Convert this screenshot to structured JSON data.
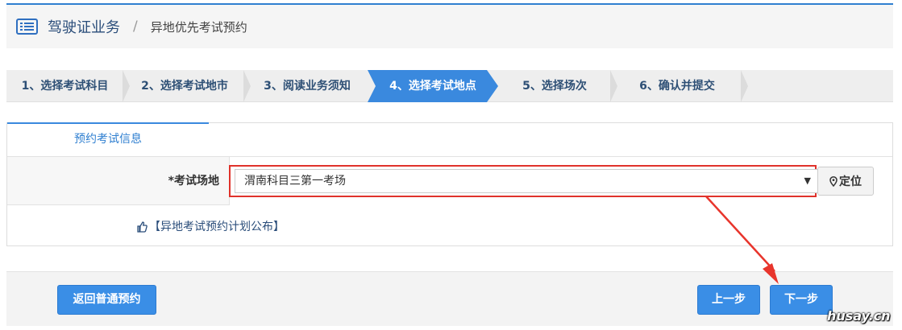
{
  "header": {
    "title": "驾驶证业务",
    "separator": "/",
    "subtitle": "异地优先考试预约"
  },
  "steps": [
    {
      "label": "1、选择考试科目",
      "active": false
    },
    {
      "label": "2、选择考试地市",
      "active": false
    },
    {
      "label": "3、阅读业务须知",
      "active": false
    },
    {
      "label": "4、选择考试地点",
      "active": true
    },
    {
      "label": "5、选择场次",
      "active": false
    },
    {
      "label": "6、确认并提交",
      "active": false
    }
  ],
  "panel": {
    "tab_label": "预约考试信息",
    "field_label": "*考试场地",
    "select_value": "渭南科目三第一考场",
    "select_caret": "▼",
    "locate_label": "定位",
    "plan_link": "【异地考试预约计划公布】"
  },
  "footer": {
    "back_label": "返回普通预约",
    "prev_label": "上一步",
    "next_label": "下一步"
  },
  "watermark": "husay.cn",
  "colors": {
    "accent": "#3a89de",
    "highlight": "#e0322b",
    "title_text": "#2a4d7a"
  }
}
